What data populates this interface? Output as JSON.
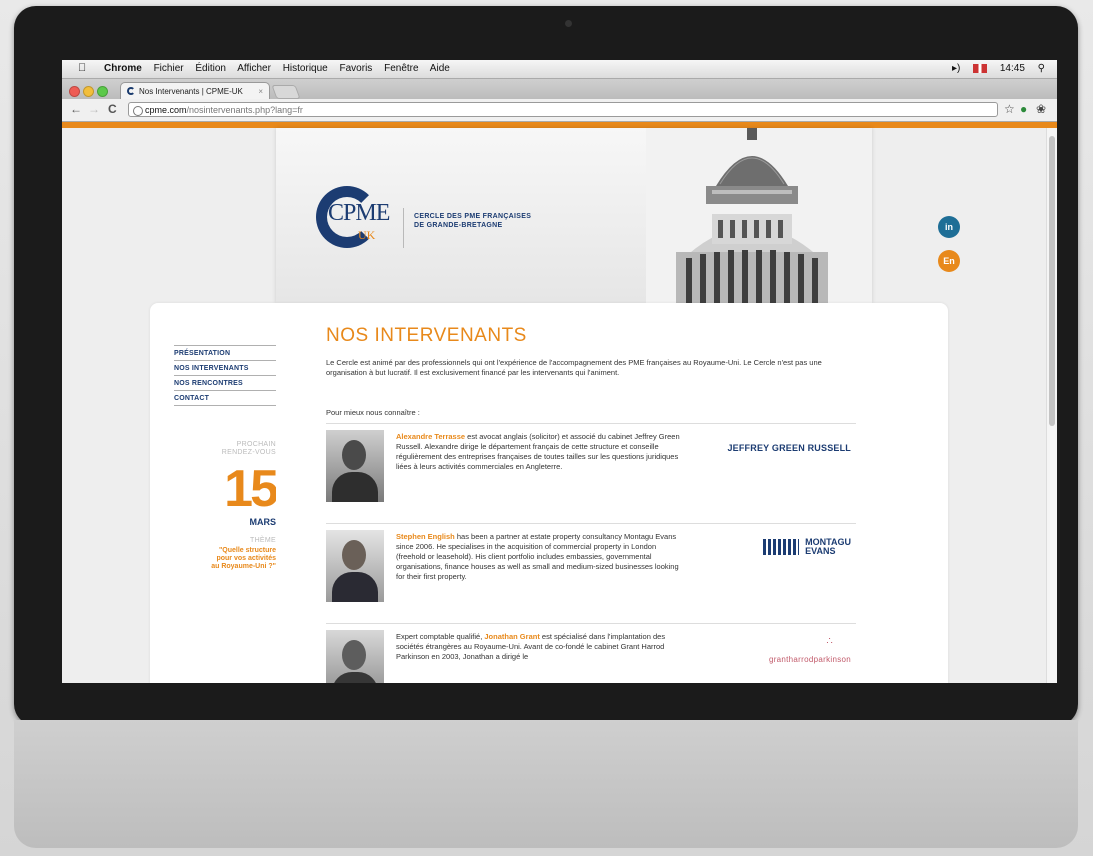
{
  "menubar": {
    "app": "Chrome",
    "items": [
      "Fichier",
      "Édition",
      "Afficher",
      "Historique",
      "Favoris",
      "Fenêtre",
      "Aide"
    ],
    "clock": "14:45"
  },
  "browser": {
    "tab_title": "Nos Intervenants | CPME-UK",
    "url_domain": "cpme.com",
    "url_path": "/nosintervenants.php?lang=fr"
  },
  "header": {
    "logo_text": "CPME",
    "logo_sub": "UK",
    "tagline_1": "CERCLE DES PME FRANÇAISES",
    "tagline_2": "DE GRANDE-BRETAGNE",
    "social_in": "in",
    "social_en": "En"
  },
  "sidebar": {
    "items": [
      "PRÉSENTATION",
      "NOS INTERVENANTS",
      "NOS RENCONTRES",
      "CONTACT"
    ]
  },
  "next_meeting": {
    "label_1": "PROCHAIN",
    "label_2": "RENDEZ-VOUS",
    "day": "15",
    "month": "MARS",
    "theme_label": "THÈME",
    "theme_1": "\"Quelle structure",
    "theme_2": "pour vos activités",
    "theme_3": "au Royaume-Uni ?\""
  },
  "main": {
    "title": "NOS INTERVENANTS",
    "intro": "Le Cercle est animé par des professionnels qui ont l'expérience de l'accompagnement des PME françaises au Royaume-Uni. Le Cercle n'est pas une organisation à but lucratif. Il est exclusivement financé par les intervenants qui l'animent.",
    "know_more": "Pour mieux nous connaître :",
    "people": [
      {
        "name": "Alexandre Terrasse",
        "pre": "",
        "post": " est avocat anglais (solicitor) et associé du cabinet Jeffrey Green Russell. Alexandre dirige le département français de cette structure et conseille régulièrement des entreprises françaises de toutes tailles sur les questions juridiques liées à leurs activités commerciales en Angleterre.",
        "firm": "JEFFREY GREEN RUSSELL"
      },
      {
        "name": "Stephen English",
        "pre": "",
        "post": " has been a partner at estate property consultancy Montagu Evans since 2006. He specialises in the acquisition of commercial property in London (freehold or leasehold). His client portfolio includes embassies, governmental organisations, finance houses as well as small and medium-sized businesses looking for their first property.",
        "firm_1": "MONTAGU",
        "firm_2": "EVANS"
      },
      {
        "name": "Jonathan Grant",
        "pre": "Expert comptable qualifié, ",
        "post": " est spécialisé dans l'implantation des sociétés étrangères au Royaume-Uni. Avant de co-fondé le cabinet Grant Harrod Parkinson en 2003, Jonathan a dirigé le",
        "firm": "grantharrodparkinson"
      }
    ]
  },
  "colors": {
    "accent": "#e8891b",
    "brand": "#1c3c72",
    "linkedin": "#1e6e96"
  },
  "icons": [
    "apple-icon",
    "volume-icon",
    "uk-flag-icon",
    "spotlight-icon",
    "back-icon",
    "forward-icon",
    "reload-icon",
    "globe-icon",
    "star-icon",
    "extension-icon",
    "wrench-icon"
  ]
}
